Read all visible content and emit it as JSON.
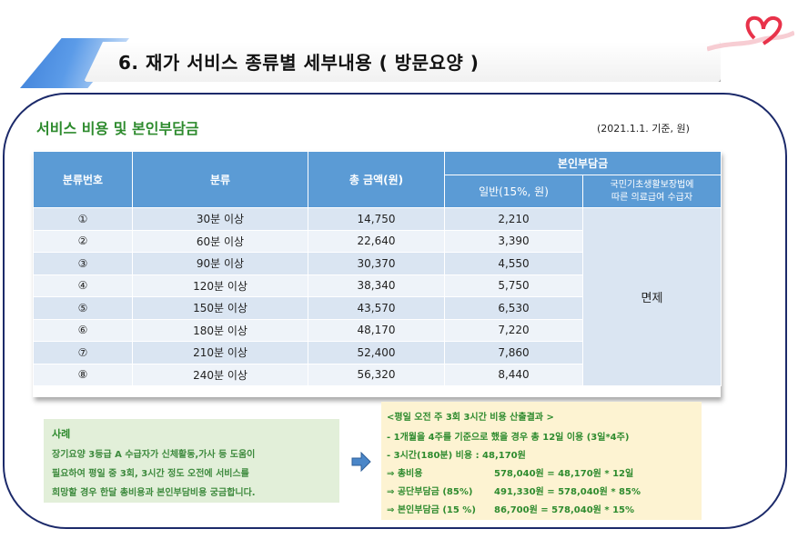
{
  "header": {
    "title": "6. 재가 서비스 종류별 세부내용 ( 방문요양 )"
  },
  "section": {
    "title": "서비스 비용  및 본인부담금",
    "basis": "(2021.1.1. 기준, 원)"
  },
  "table": {
    "headers": {
      "number": "분류번호",
      "category": "분류",
      "total": "총 금액(원)",
      "copay": "본인부담금",
      "general": "일반(15%, 원)",
      "basic_line1": "국민기초생활보장법에",
      "basic_line2": "따른 의료급여 수급자"
    },
    "exempt": "면제",
    "rows": [
      {
        "num": "①",
        "category": "30분 이상",
        "total": "14,750",
        "general": "2,210"
      },
      {
        "num": "②",
        "category": "60분 이상",
        "total": "22,640",
        "general": "3,390"
      },
      {
        "num": "③",
        "category": "90분 이상",
        "total": "30,370",
        "general": "4,550"
      },
      {
        "num": "④",
        "category": "120분 이상",
        "total": "38,340",
        "general": "5,750"
      },
      {
        "num": "⑤",
        "category": "150분 이상",
        "total": "43,570",
        "general": "6,530"
      },
      {
        "num": "⑥",
        "category": "180분 이상",
        "total": "48,170",
        "general": "7,220"
      },
      {
        "num": "⑦",
        "category": "210분 이상",
        "total": "52,400",
        "general": "7,860"
      },
      {
        "num": "⑧",
        "category": "240분 이상",
        "total": "56,320",
        "general": "8,440"
      }
    ]
  },
  "example": {
    "title": "사례",
    "line1": "장기요양 3등급 A 수급자가  신체활동,가사 등 도움이",
    "line2": "필요하여 평일 중 3회, 3시간 정도 오전에 서비스를",
    "line3": "희망할 경우 한달 총비용과 본인부담비용 궁금합니다."
  },
  "calc": {
    "title": "<평일 오전 주 3회 3시간 비용 산출결과 >",
    "line1": "- 1개월을 4주를 기준으로 했을 경우 총 12일 이용 (3일*4주)",
    "line2": "- 3시간(180분) 비용 : 48,170원",
    "line3_label": "⇒ 총비용",
    "line3_value": "578,040원 = 48,170원 * 12일",
    "line4_label": "⇒ 공단부담금 (85%)",
    "line4_value": "491,330원 = 578,040원 * 85%",
    "line5_label": "⇒ 본인부담금 (15 %)",
    "line5_value": "86,700원 = 578,040원 * 15%"
  },
  "colors": {
    "header_blue": "#5b9bd5",
    "row_light": "#dae5f2",
    "example_bg": "#e2efd9",
    "calc_bg": "#fdf3d2",
    "green_text": "#2e8b2e",
    "frame_navy": "#1c2a6a"
  },
  "icons": {
    "decoration": "heart-ribbon-icon",
    "arrow": "arrow-right-icon"
  }
}
